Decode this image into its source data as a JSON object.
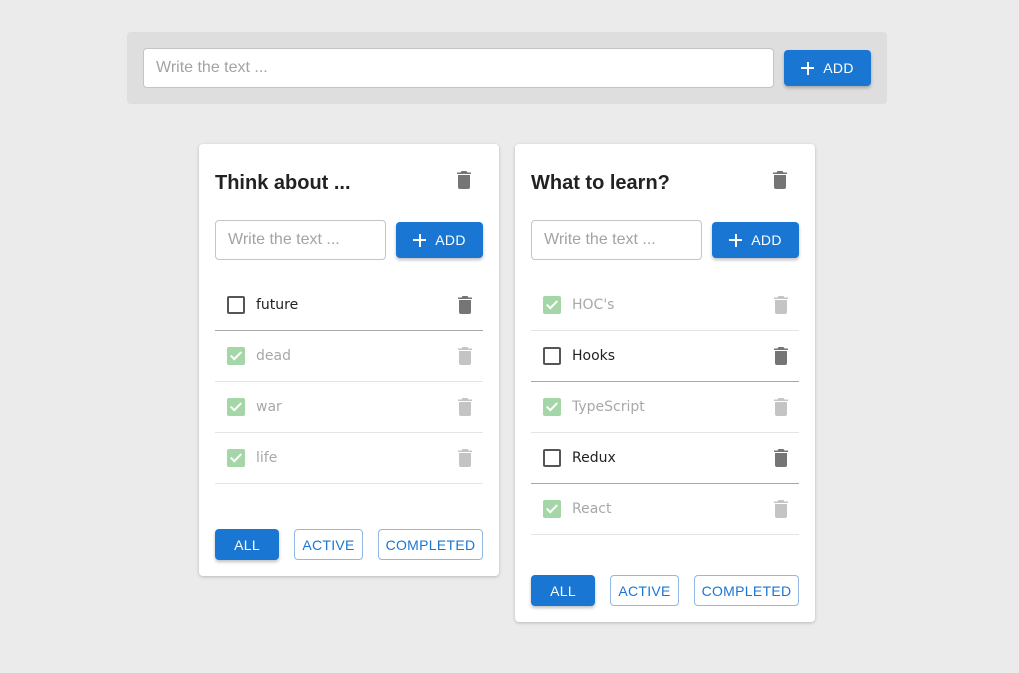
{
  "top": {
    "placeholder": "Write the text ...",
    "add_label": "ADD"
  },
  "lists": [
    {
      "title": "Think about ...",
      "placeholder": "Write the text ...",
      "add_label": "ADD",
      "tasks": [
        {
          "text": "future",
          "done": false
        },
        {
          "text": "dead",
          "done": true
        },
        {
          "text": "war",
          "done": true
        },
        {
          "text": "life",
          "done": true
        }
      ],
      "filters": {
        "all": "ALL",
        "active": "ACTIVE",
        "completed": "COMPLETED",
        "selected": "all"
      }
    },
    {
      "title": "What to learn?",
      "placeholder": "Write the text ...",
      "add_label": "ADD",
      "tasks": [
        {
          "text": "HOC's",
          "done": true
        },
        {
          "text": "Hooks",
          "done": false
        },
        {
          "text": "TypeScript",
          "done": true
        },
        {
          "text": "Redux",
          "done": false
        },
        {
          "text": "React",
          "done": true
        }
      ],
      "filters": {
        "all": "ALL",
        "active": "ACTIVE",
        "completed": "COMPLETED",
        "selected": "all"
      }
    }
  ],
  "colors": {
    "primary": "#1976d2",
    "checked": "#a5d6a7",
    "trash_active": "#757575",
    "trash_done": "#c4c4c4"
  },
  "icons": {
    "add": "plus-icon",
    "delete": "trash-icon",
    "checkbox": "checkbox-icon"
  }
}
